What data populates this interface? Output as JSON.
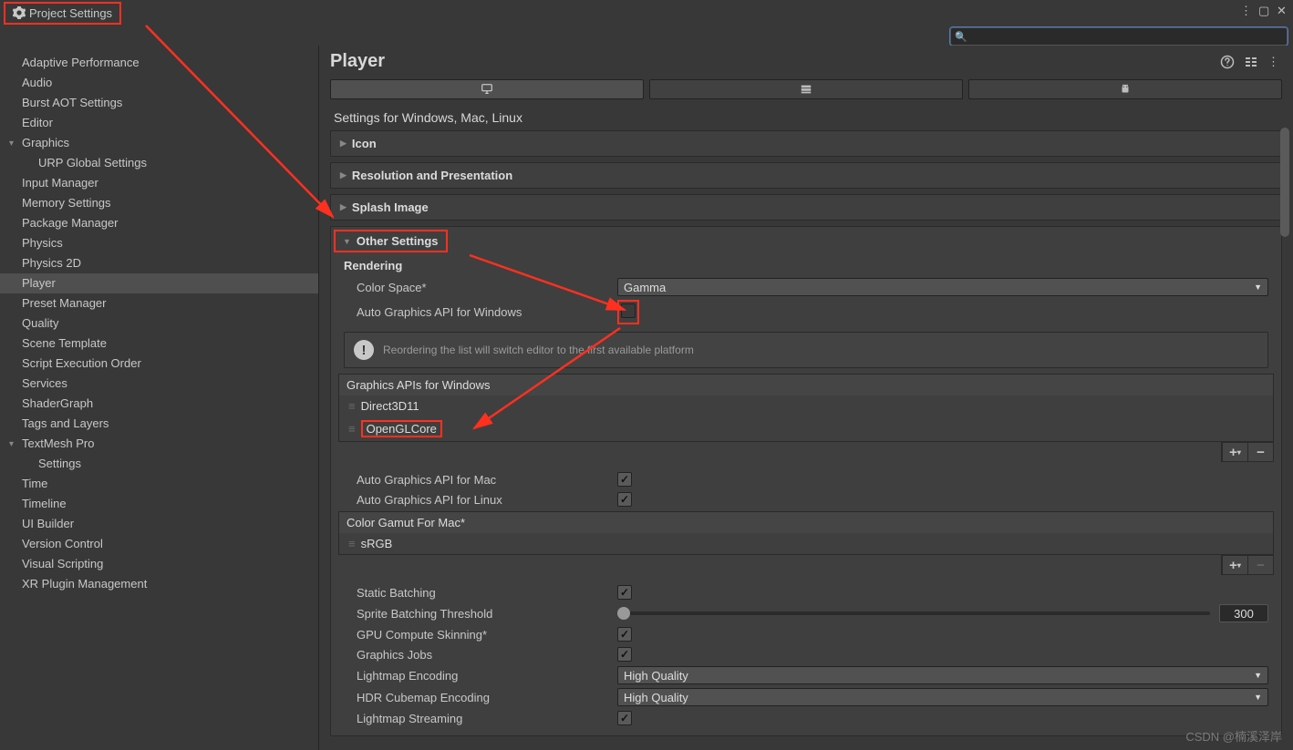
{
  "window": {
    "title": "Project Settings"
  },
  "search": {
    "placeholder": ""
  },
  "sidebar": {
    "items": [
      {
        "label": "Adaptive Performance",
        "expandable": false,
        "child": false
      },
      {
        "label": "Audio",
        "expandable": false,
        "child": false
      },
      {
        "label": "Burst AOT Settings",
        "expandable": false,
        "child": false
      },
      {
        "label": "Editor",
        "expandable": false,
        "child": false
      },
      {
        "label": "Graphics",
        "expandable": true,
        "child": false
      },
      {
        "label": "URP Global Settings",
        "expandable": false,
        "child": true
      },
      {
        "label": "Input Manager",
        "expandable": false,
        "child": false
      },
      {
        "label": "Memory Settings",
        "expandable": false,
        "child": false
      },
      {
        "label": "Package Manager",
        "expandable": false,
        "child": false
      },
      {
        "label": "Physics",
        "expandable": false,
        "child": false
      },
      {
        "label": "Physics 2D",
        "expandable": false,
        "child": false
      },
      {
        "label": "Player",
        "expandable": false,
        "child": false,
        "selected": true
      },
      {
        "label": "Preset Manager",
        "expandable": false,
        "child": false
      },
      {
        "label": "Quality",
        "expandable": false,
        "child": false
      },
      {
        "label": "Scene Template",
        "expandable": false,
        "child": false
      },
      {
        "label": "Script Execution Order",
        "expandable": false,
        "child": false
      },
      {
        "label": "Services",
        "expandable": false,
        "child": false
      },
      {
        "label": "ShaderGraph",
        "expandable": false,
        "child": false
      },
      {
        "label": "Tags and Layers",
        "expandable": false,
        "child": false
      },
      {
        "label": "TextMesh Pro",
        "expandable": true,
        "child": false
      },
      {
        "label": "Settings",
        "expandable": false,
        "child": true
      },
      {
        "label": "Time",
        "expandable": false,
        "child": false
      },
      {
        "label": "Timeline",
        "expandable": false,
        "child": false
      },
      {
        "label": "UI Builder",
        "expandable": false,
        "child": false
      },
      {
        "label": "Version Control",
        "expandable": false,
        "child": false
      },
      {
        "label": "Visual Scripting",
        "expandable": false,
        "child": false
      },
      {
        "label": "XR Plugin Management",
        "expandable": false,
        "child": false
      }
    ]
  },
  "header": {
    "title": "Player"
  },
  "platform": {
    "subtitle": "Settings for Windows, Mac, Linux"
  },
  "foldouts": {
    "icon": "Icon",
    "resolution": "Resolution and Presentation",
    "splash": "Splash Image",
    "other": "Other Settings"
  },
  "rendering": {
    "title": "Rendering",
    "colorSpaceLabel": "Color Space*",
    "colorSpaceValue": "Gamma",
    "autoWinLabel": "Auto Graphics API  for Windows",
    "infoText": "Reordering the list will switch editor to the first available platform",
    "apisHeader": "Graphics APIs for Windows",
    "api0": "Direct3D11",
    "api1": "OpenGLCore",
    "autoMacLabel": "Auto Graphics API  for Mac",
    "autoLinuxLabel": "Auto Graphics API  for Linux",
    "gamutHeader": "Color Gamut For Mac*",
    "gamut0": "sRGB",
    "staticBatching": "Static Batching",
    "spriteThreshold": "Sprite Batching Threshold",
    "spriteThresholdValue": "300",
    "gpuSkinning": "GPU Compute Skinning*",
    "graphicsJobs": "Graphics Jobs",
    "lightmapEnc": "Lightmap Encoding",
    "lightmapEncValue": "High Quality",
    "hdrEnc": "HDR Cubemap Encoding",
    "hdrEncValue": "High Quality",
    "lightmapStream": "Lightmap Streaming"
  },
  "watermark": "CSDN @楠溪泽岸"
}
